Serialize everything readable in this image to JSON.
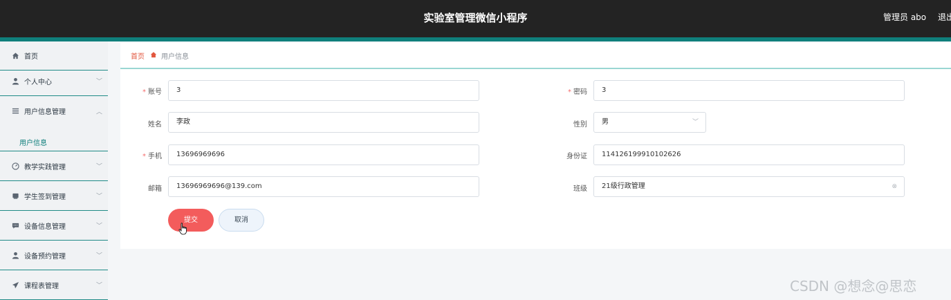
{
  "header": {
    "title": "实验室管理微信小程序",
    "admin": "管理员 abo",
    "logout": "退出"
  },
  "sidebar": {
    "items": [
      {
        "label": "首页",
        "icon": "home-icon"
      },
      {
        "label": "个人中心",
        "icon": "user-icon"
      },
      {
        "label": "用户信息管理",
        "icon": "menu-icon"
      },
      {
        "label": "教学实践管理",
        "icon": "gauge-icon"
      },
      {
        "label": "学生签到管理",
        "icon": "card-icon"
      },
      {
        "label": "设备信息管理",
        "icon": "chat-icon"
      },
      {
        "label": "设备预约管理",
        "icon": "user-icon"
      },
      {
        "label": "课程表管理",
        "icon": "send-icon"
      }
    ],
    "sub_item": "用户信息"
  },
  "breadcrumb": {
    "home": "首页",
    "current": "用户信息"
  },
  "form": {
    "account": {
      "label": "账号",
      "value": "3"
    },
    "password": {
      "label": "密码",
      "value": "3"
    },
    "name": {
      "label": "姓名",
      "value": "李政"
    },
    "gender": {
      "label": "性别",
      "value": "男"
    },
    "phone": {
      "label": "手机",
      "value": "13696969696"
    },
    "id_card": {
      "label": "身份证",
      "value": "114126199910102626"
    },
    "email": {
      "label": "邮箱",
      "value": "13696969696@139.com"
    },
    "class": {
      "label": "班级",
      "value": "21级行政管理"
    },
    "submit": "提交",
    "cancel": "取消"
  },
  "watermark": "CSDN @想念@思恋",
  "colors": {
    "header_bg": "#232323",
    "accent": "#0f7f7b",
    "submit_bg": "#f35c5c",
    "breadcrumb_home": "#e2573f"
  }
}
